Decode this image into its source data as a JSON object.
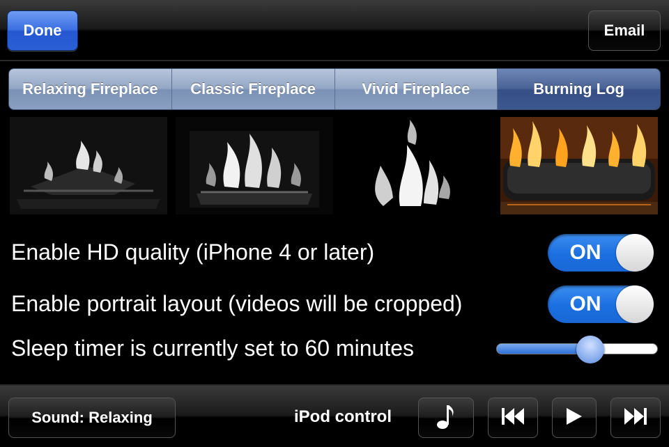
{
  "top_bar": {
    "done_label": "Done",
    "email_label": "Email"
  },
  "segments": {
    "items": [
      "Relaxing Fireplace",
      "Classic Fireplace",
      "Vivid Fireplace",
      "Burning Log"
    ],
    "selected": "Burning Log"
  },
  "settings": {
    "hd_label": "Enable HD quality (iPhone 4 or later)",
    "hd_state": "ON",
    "portrait_label": "Enable portrait layout (videos will be cropped)",
    "portrait_state": "ON",
    "sleep_label": "Sleep timer is currently set to 60 minutes",
    "sleep_slider_fraction": 0.58
  },
  "bottom_bar": {
    "sound_label": "Sound: Relaxing",
    "ipod_label": "iPod control",
    "controls": [
      "music-note-icon",
      "previous-track-icon",
      "play-icon",
      "next-track-icon"
    ]
  },
  "colors": {
    "accent_blue": "#2a5fd6",
    "segment_color": "#8aa0c2",
    "segment_selected": "#3c578f",
    "toggle_on": "#1b6fe0"
  }
}
